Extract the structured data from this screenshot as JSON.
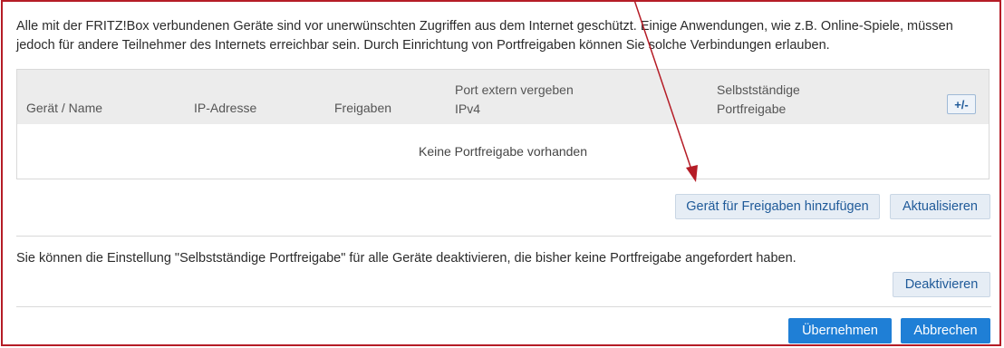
{
  "intro_text": "Alle mit der FRITZ!Box verbundenen Geräte sind vor unerwünschten Zugriffen aus dem Internet geschützt. Einige Anwendungen, wie z.B. Online-Spiele, müssen jedoch für andere Teilnehmer des Internets erreichbar sein. Durch Einrichtung von Portfreigaben können Sie solche Verbindungen erlauben.",
  "table": {
    "columns": {
      "device": "Gerät / Name",
      "ip": "IP-Adresse",
      "shares": "Freigaben",
      "port_line1": "Port extern vergeben",
      "port_line2": "IPv4",
      "self_line1": "Selbstständige",
      "self_line2": "Portfreigabe"
    },
    "plus_minus_label": "+/-",
    "empty_message": "Keine Portfreigabe vorhanden"
  },
  "buttons": {
    "add_device": "Gerät für Freigaben hinzufügen",
    "refresh": "Aktualisieren",
    "deactivate": "Deaktivieren",
    "apply": "Übernehmen",
    "cancel": "Abbrechen"
  },
  "deactivate_note": "Sie können die Einstellung \"Selbstständige Portfreigabe\" für alle Geräte deaktivieren, die bisher keine Portfreigabe angefordert haben.",
  "colors": {
    "frame": "#b51c26",
    "primary_button": "#1f7fd6",
    "secondary_button": "#e6edf5",
    "annotation_arrow": "#b51c26"
  }
}
